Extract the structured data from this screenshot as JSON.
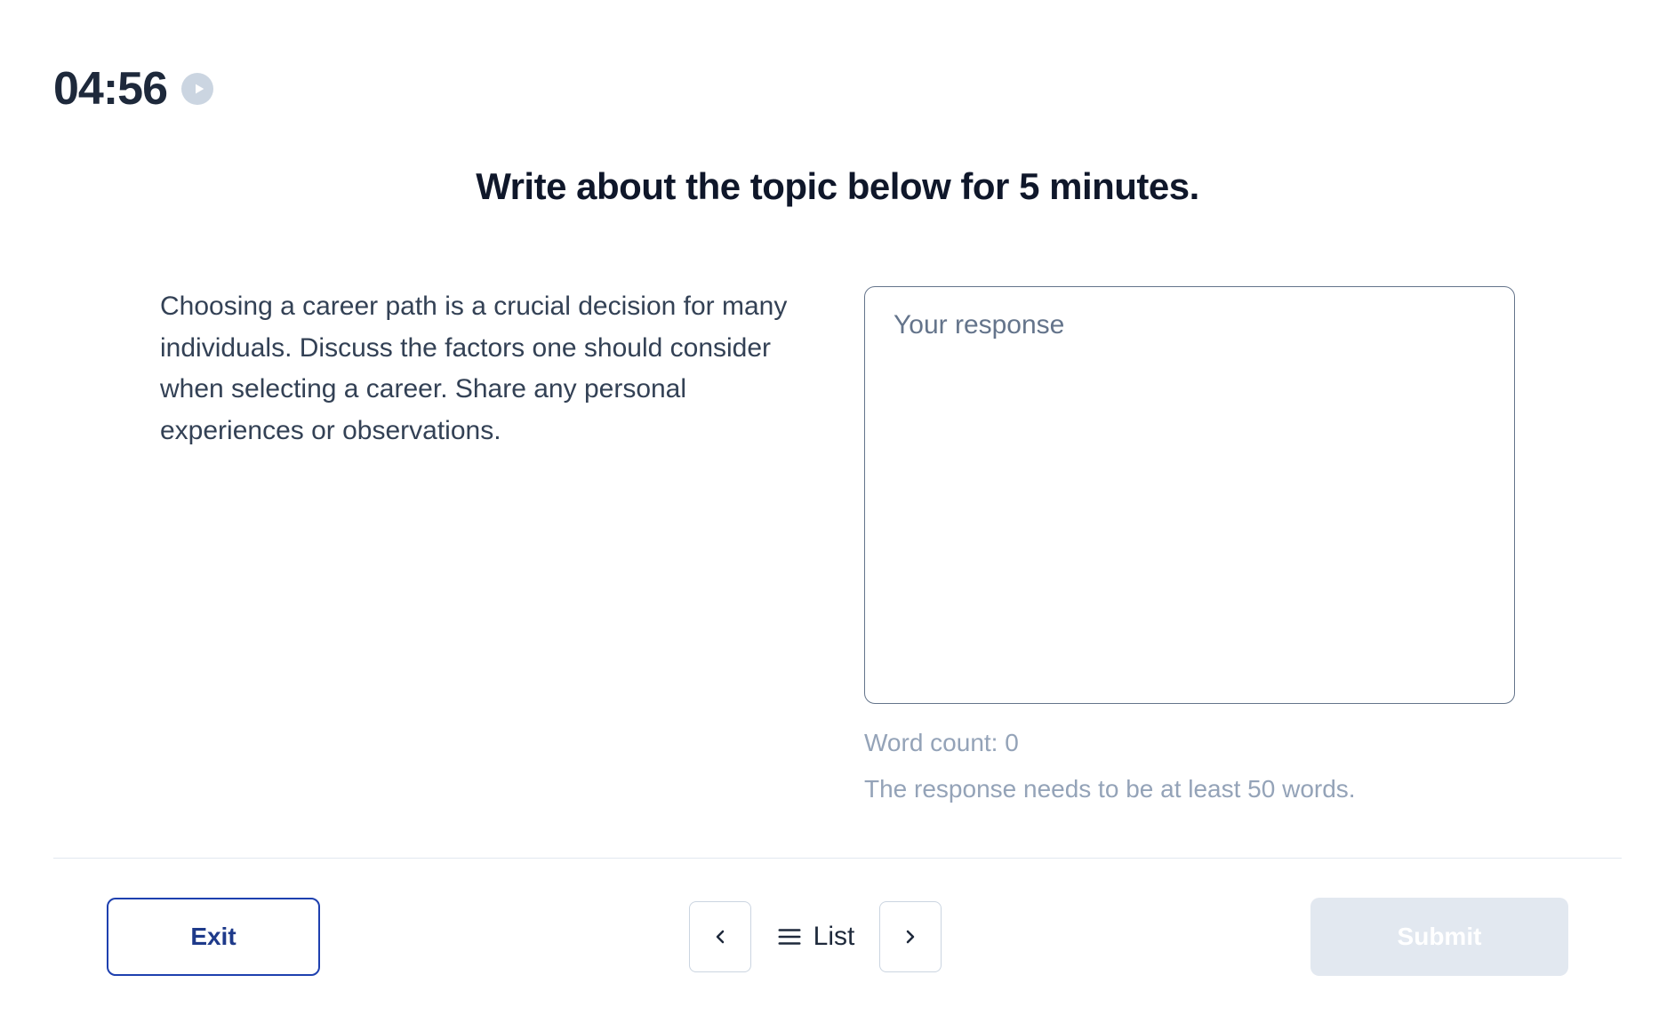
{
  "timer": {
    "value": "04:56"
  },
  "heading": "Write about the topic below for 5 minutes.",
  "prompt": {
    "text": "Choosing a career path is a crucial decision for many individuals. Discuss the factors one should consider when selecting a career. Share any personal experiences or observations."
  },
  "response": {
    "placeholder": "Your response",
    "value": "",
    "word_count_label": "Word count: 0",
    "hint": "The response needs to be at least 50 words."
  },
  "footer": {
    "exit_label": "Exit",
    "list_label": "List",
    "submit_label": "Submit"
  }
}
